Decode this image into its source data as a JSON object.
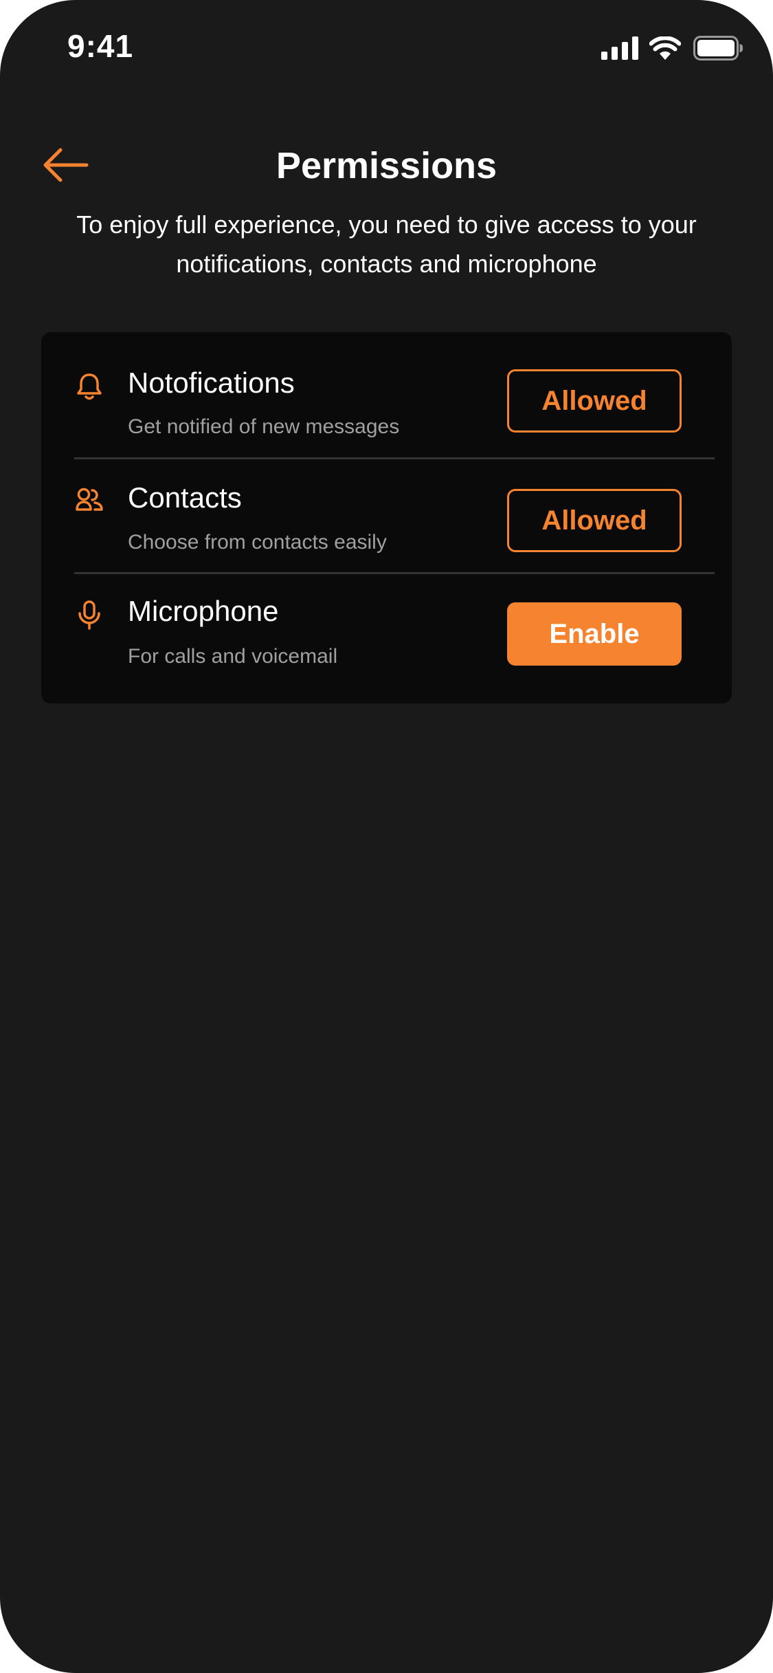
{
  "status_bar": {
    "time": "9:41",
    "icons": [
      "signal-icon",
      "wifi-icon",
      "battery-icon"
    ]
  },
  "header": {
    "back_icon": "back-arrow-icon",
    "title": "Permissions",
    "subtitle": "To enjoy full experience, you need to give access to your notifications, contacts and microphone"
  },
  "permissions": [
    {
      "icon": "bell-icon",
      "title": "Notofications",
      "description": "Get notified of new messages",
      "button_label": "Allowed",
      "button_style": "outline"
    },
    {
      "icon": "contacts-icon",
      "title": "Contacts",
      "description": "Choose from contacts easily",
      "button_label": "Allowed",
      "button_style": "outline"
    },
    {
      "icon": "microphone-icon",
      "title": "Microphone",
      "description": "For calls and voicemail",
      "button_label": "Enable",
      "button_style": "filled"
    }
  ],
  "colors": {
    "background": "#1a1a1a",
    "card": "#0a0a0a",
    "accent": "#f5832f",
    "text_primary": "#ffffff",
    "text_secondary": "#a0a0a0"
  }
}
